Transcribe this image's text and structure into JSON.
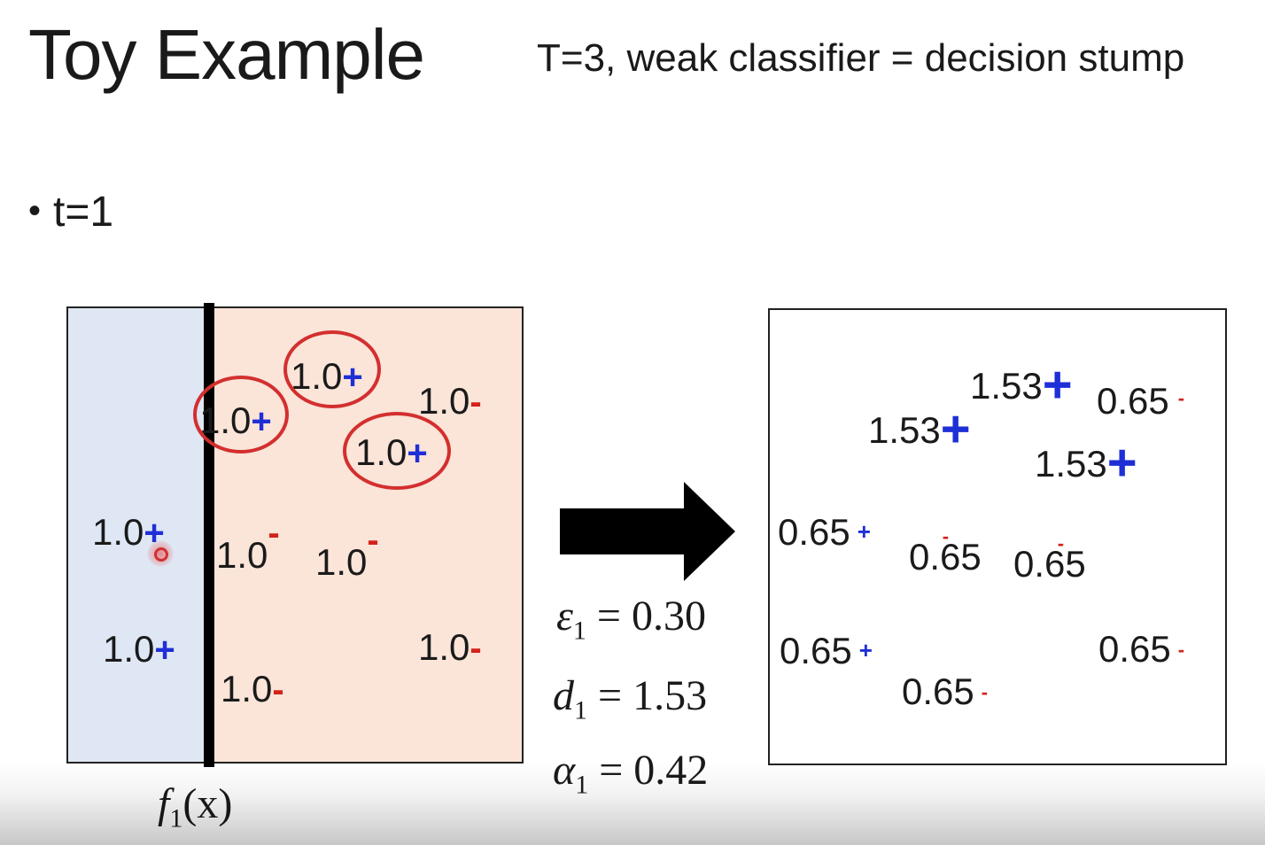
{
  "slide": {
    "title": "Toy Example",
    "subtitle": "T=3, weak classifier = decision stump",
    "bullet": "t=1"
  },
  "left_plot": {
    "label_func": "f",
    "label_sub": "1",
    "label_arg": "(x)",
    "points": [
      {
        "weight": "1.0",
        "sign": "+"
      },
      {
        "weight": "1.0",
        "sign": "+"
      },
      {
        "weight": "1.0",
        "sign": "-"
      },
      {
        "weight": "1.0",
        "sign": "+"
      },
      {
        "weight": "1.0",
        "sign": "+"
      },
      {
        "weight": "1.0",
        "sign": "-"
      },
      {
        "weight": "1.0",
        "sign": "-"
      },
      {
        "weight": "1.0",
        "sign": "+"
      },
      {
        "weight": "1.0",
        "sign": "-"
      },
      {
        "weight": "1.0",
        "sign": "-"
      }
    ]
  },
  "right_plot": {
    "points": [
      {
        "weight": "1.53",
        "sign": "+"
      },
      {
        "weight": "0.65",
        "sign": "-"
      },
      {
        "weight": "1.53",
        "sign": "+"
      },
      {
        "weight": "1.53",
        "sign": "+"
      },
      {
        "weight": "0.65",
        "sign": "+"
      },
      {
        "weight": "0.65",
        "sign": "-"
      },
      {
        "weight": "0.65",
        "sign": "-"
      },
      {
        "weight": "0.65",
        "sign": "+"
      },
      {
        "weight": "0.65",
        "sign": "-"
      },
      {
        "weight": "0.65",
        "sign": "-"
      }
    ]
  },
  "equations": [
    {
      "symbol": "ε",
      "sub": "1",
      "rhs": "= 0.30"
    },
    {
      "symbol": "d",
      "sub": "1",
      "rhs": "= 1.53"
    },
    {
      "symbol": "α",
      "sub": "1",
      "rhs": "= 0.42"
    }
  ],
  "colors": {
    "positive": "#1f2fd6",
    "negative": "#d2231a",
    "highlight_circle": "#d32f2f",
    "negative_region": "#dfe7f4",
    "positive_region": "#fbe4d8"
  }
}
